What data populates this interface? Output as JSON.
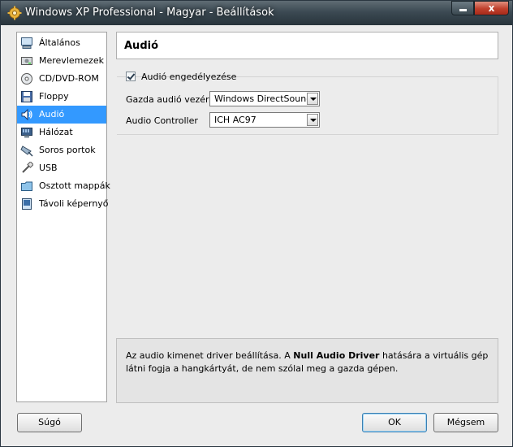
{
  "window": {
    "title": "Windows XP Professional - Magyar - Beállítások",
    "close_glyph": "x"
  },
  "sidebar": {
    "items": [
      {
        "label": "Általános",
        "icon": "monitor-icon"
      },
      {
        "label": "Merevlemezek",
        "icon": "hard-disk-icon"
      },
      {
        "label": "CD/DVD-ROM",
        "icon": "cd-dvd-icon"
      },
      {
        "label": "Floppy",
        "icon": "floppy-icon"
      },
      {
        "label": "Audió",
        "icon": "speaker-icon",
        "selected": true
      },
      {
        "label": "Hálózat",
        "icon": "network-icon"
      },
      {
        "label": "Soros portok",
        "icon": "serial-port-icon"
      },
      {
        "label": "USB",
        "icon": "usb-icon"
      },
      {
        "label": "Osztott mappák",
        "icon": "folder-icon"
      },
      {
        "label": "Távoli képernyő",
        "icon": "remote-display-icon"
      }
    ]
  },
  "page": {
    "title": "Audió",
    "enable_audio": {
      "label": "Audió engedélyezése",
      "checked": true
    },
    "host_driver": {
      "label": "Gazda audió vezérlő",
      "value": "Windows DirectSound"
    },
    "controller": {
      "label": "Audio Controller",
      "value": "ICH AC97"
    },
    "info": {
      "part1": "Az audio kimenet driver beállítása. A ",
      "bold": "Null Audio Driver",
      "part2": " hatására a virtuális gép látni fogja a hangkártyát, de nem szólal meg a gazda gépen."
    }
  },
  "buttons": {
    "help": "Súgó",
    "ok": "OK",
    "cancel": "Mégsem"
  },
  "colors": {
    "selection": "#3399ff",
    "close_button": "#c0402c",
    "ok_border": "#3c7fb1"
  }
}
